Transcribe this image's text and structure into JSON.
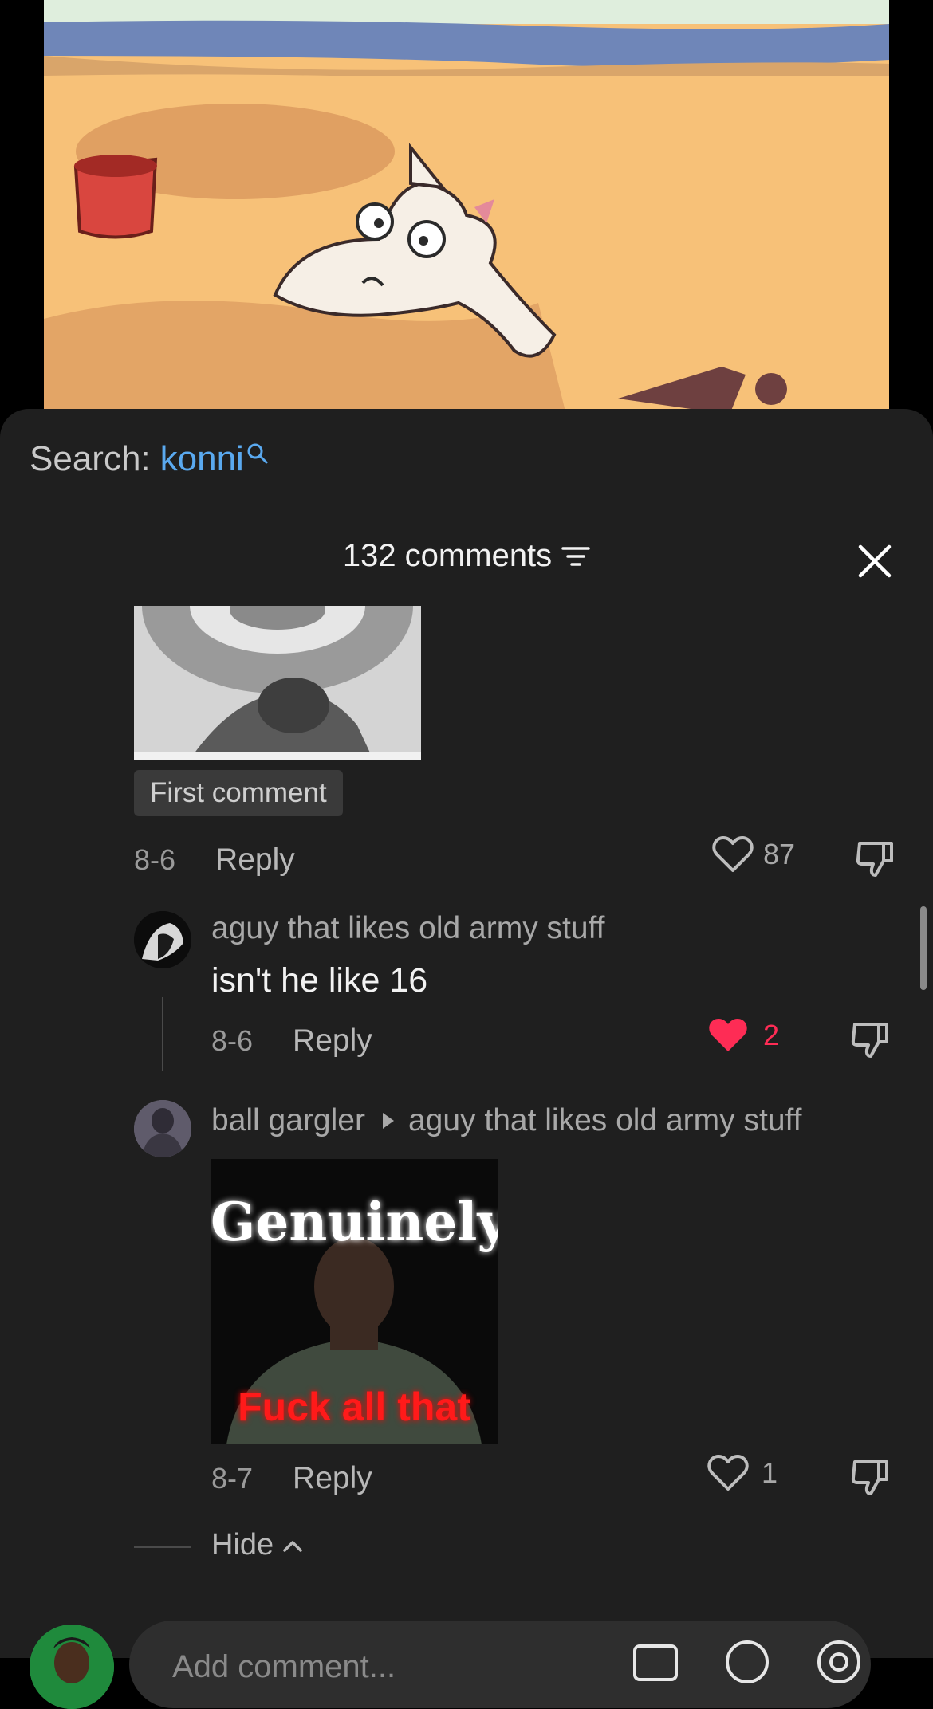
{
  "search": {
    "label": "Search:",
    "keyword": "konni"
  },
  "header": {
    "count_label": "132 comments"
  },
  "comments": [
    {
      "badge": "First comment",
      "date": "8-6",
      "reply_label": "Reply",
      "likes": "87"
    },
    {
      "author": "aguy that likes old army stuff",
      "text": "isn't he like 16",
      "date": "8-6",
      "reply_label": "Reply",
      "likes": "2",
      "liked": true
    },
    {
      "author": "ball gargler",
      "reply_to": "aguy that likes old army stuff",
      "meme_top": "Genuinely",
      "meme_bottom": "Fuck all that",
      "date": "8-7",
      "reply_label": "Reply",
      "likes": "1"
    }
  ],
  "hide_label": "Hide",
  "input": {
    "placeholder": "Add comment..."
  },
  "colors": {
    "accent": "#fe2c55",
    "link": "#5aa9ef",
    "sheet": "#1f1f1f"
  },
  "icons": [
    "search-icon",
    "filter-icon",
    "close-icon",
    "heart-icon",
    "dislike-icon",
    "play-triangle-icon",
    "chevron-up-icon",
    "image-icon",
    "emoji-icon",
    "mention-icon"
  ]
}
